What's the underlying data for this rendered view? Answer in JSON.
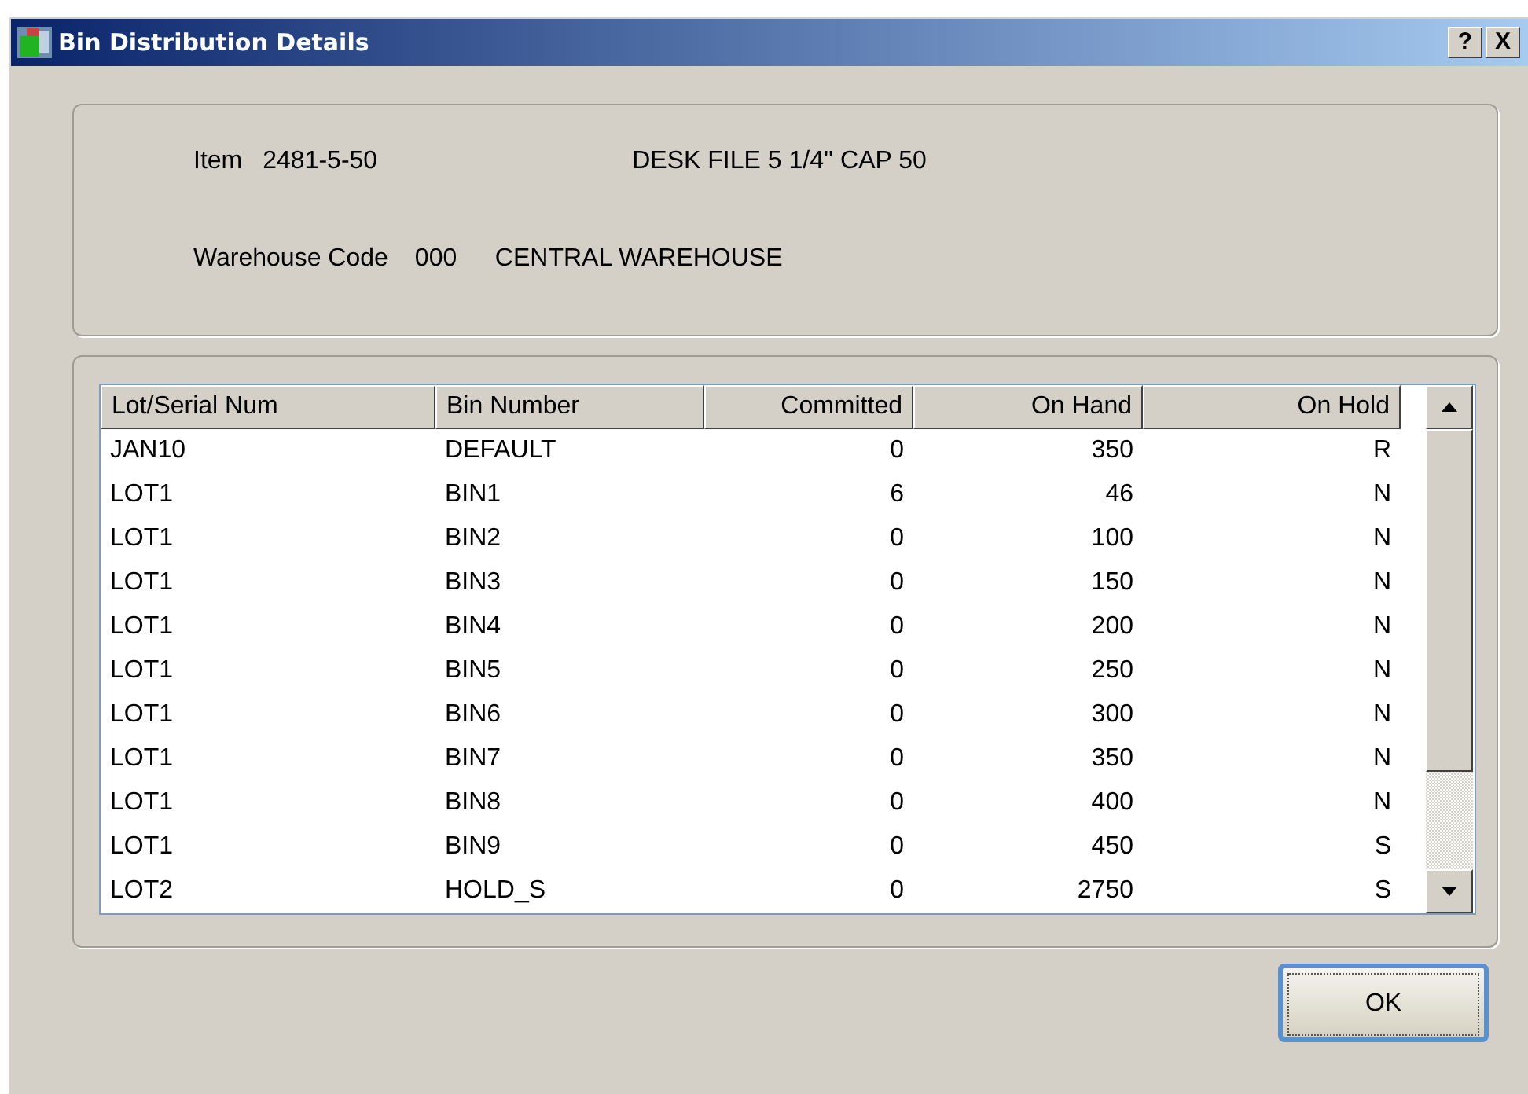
{
  "window": {
    "title": "Bin Distribution Details",
    "help_button": "?",
    "close_button": "X"
  },
  "item": {
    "label": "Item",
    "code": "2481-5-50",
    "description": "DESK FILE 5 1/4'' CAP 50"
  },
  "warehouse": {
    "label": "Warehouse Code",
    "code": "000",
    "description": "CENTRAL WAREHOUSE"
  },
  "table": {
    "columns": [
      {
        "label": "Lot/Serial Num",
        "right_aligned": false
      },
      {
        "label": "Bin Number",
        "right_aligned": false
      },
      {
        "label": "Committed",
        "right_aligned": true
      },
      {
        "label": "On Hand",
        "right_aligned": true
      },
      {
        "label": "On Hold",
        "right_aligned": true
      }
    ],
    "rows": [
      [
        "JAN10",
        "DEFAULT",
        "0",
        "350",
        "R"
      ],
      [
        "LOT1",
        "BIN1",
        "6",
        "46",
        "N"
      ],
      [
        "LOT1",
        "BIN2",
        "0",
        "100",
        "N"
      ],
      [
        "LOT1",
        "BIN3",
        "0",
        "150",
        "N"
      ],
      [
        "LOT1",
        "BIN4",
        "0",
        "200",
        "N"
      ],
      [
        "LOT1",
        "BIN5",
        "0",
        "250",
        "N"
      ],
      [
        "LOT1",
        "BIN6",
        "0",
        "300",
        "N"
      ],
      [
        "LOT1",
        "BIN7",
        "0",
        "350",
        "N"
      ],
      [
        "LOT1",
        "BIN8",
        "0",
        "400",
        "N"
      ],
      [
        "LOT1",
        "BIN9",
        "0",
        "450",
        "S"
      ],
      [
        "LOT2",
        "HOLD_S",
        "0",
        "2750",
        "S"
      ]
    ]
  },
  "buttons": [
    {
      "label": "OK",
      "default": true
    }
  ]
}
